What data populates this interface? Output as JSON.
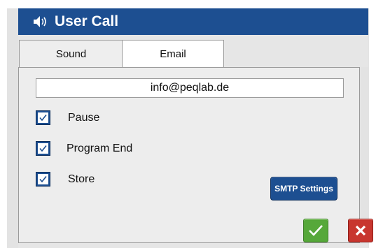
{
  "window": {
    "title": "User Call",
    "accent": "#1d4f91"
  },
  "tabs": [
    {
      "label": "Sound",
      "selected": false
    },
    {
      "label": "Email",
      "selected": true
    }
  ],
  "email": {
    "value": "info@peqlab.de"
  },
  "options": [
    {
      "label": "Pause",
      "checked": true
    },
    {
      "label": "Program End",
      "checked": true
    },
    {
      "label": "Store",
      "checked": true
    }
  ],
  "buttons": {
    "smtp_label": "SMTP Settings",
    "ok_icon": "checkmark-icon",
    "cancel_icon": "close-icon",
    "ok_color": "#56a83a",
    "cancel_color": "#c8362f"
  }
}
